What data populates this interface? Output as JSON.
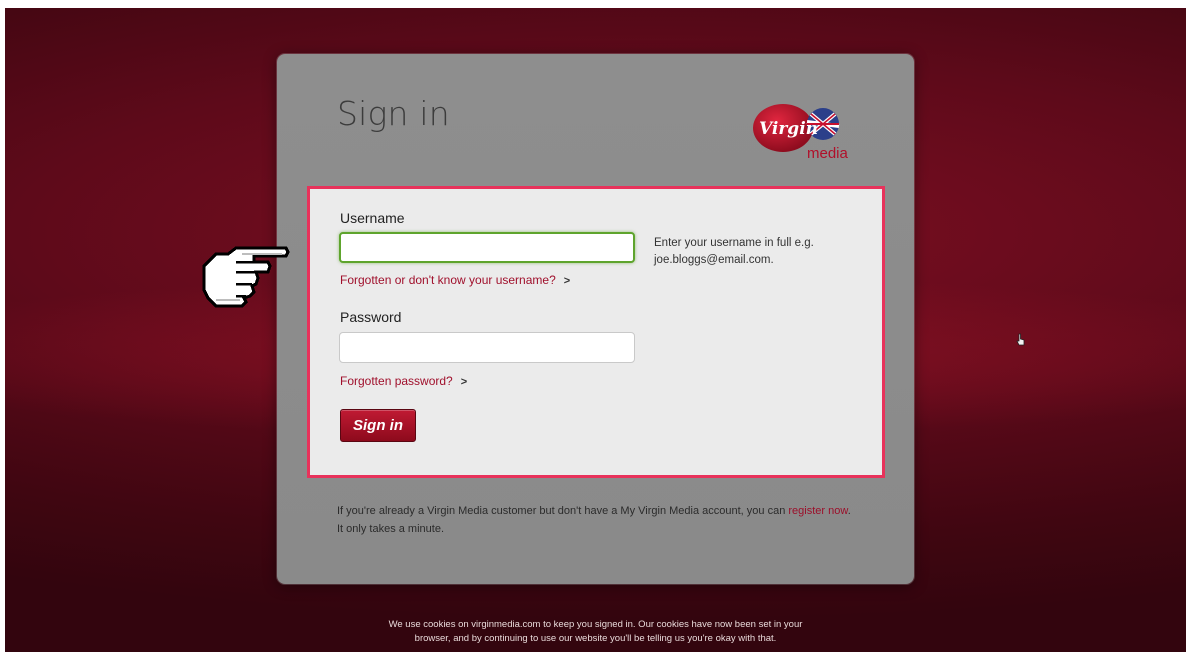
{
  "signin": {
    "title": "Sign in",
    "brand": {
      "word": "Virgin",
      "sub": "media"
    },
    "username": {
      "label": "Username",
      "value": "",
      "help": "Enter your username in full e.g. joe.bloggs@email.com.",
      "forgot_link": "Forgotten or don't know your username?"
    },
    "password": {
      "label": "Password",
      "value": "",
      "forgot_link": "Forgotten password?"
    },
    "submit_label": "Sign in",
    "chevron": ">"
  },
  "info": {
    "text_before": "If you're already a Virgin Media customer but don't have a My Virgin Media account, you can",
    "register_link": "register now",
    "text_after": ". It only takes a minute."
  },
  "cookie": {
    "line1": "We use cookies on virginmedia.com to keep you signed in. Our cookies have now been set in your",
    "line2": "browser, and by continuing to use our website you'll be telling us you're okay with that."
  },
  "colors": {
    "accent": "#a0102c",
    "highlight_border": "#e8325b",
    "focus_border": "#5ea42d",
    "panel": "#8e8e8e"
  },
  "icons": {
    "pointer": "pointing-hand-icon",
    "cursor": "mouse-cursor-icon",
    "logo": "virgin-media-logo"
  }
}
